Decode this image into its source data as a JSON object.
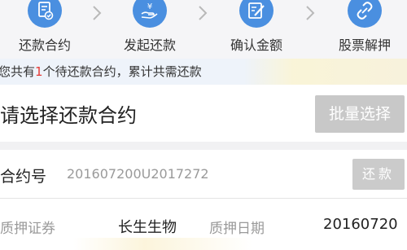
{
  "steps": [
    {
      "label": "还款合约",
      "icon": "contract-check-icon"
    },
    {
      "label": "发起还款",
      "icon": "yen-hand-icon"
    },
    {
      "label": "确认金额",
      "icon": "edit-document-icon"
    },
    {
      "label": "股票解押",
      "icon": "unlink-icon"
    }
  ],
  "banner": {
    "prefix": "您共有",
    "count": "1",
    "suffix": "个待还款合约，累计共需还款"
  },
  "select": {
    "title": "请选择还款合约",
    "batch_button": "批量选择"
  },
  "contract": {
    "label": "合约号",
    "number": "201607200U2017272",
    "repay_button": "还款",
    "fields": [
      {
        "label": "质押证券",
        "value": "长生生物"
      },
      {
        "label": "质押日期",
        "value": "20160720"
      }
    ]
  },
  "colors": {
    "accent": "#4a8fe0",
    "count_red": "#e53935",
    "button_disabled": "#c8c8c8"
  }
}
